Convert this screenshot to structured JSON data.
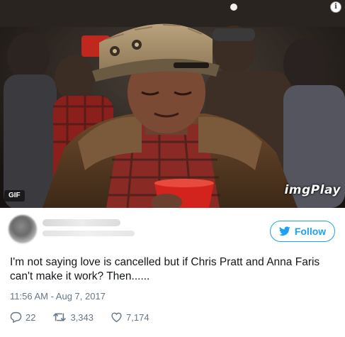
{
  "media": {
    "gif_badge": "GIF",
    "watermark": "imgPlay",
    "info_icon": "info-icon"
  },
  "author": {
    "name": "",
    "handle": ""
  },
  "follow_button": {
    "label": "Follow",
    "icon": "twitter-bird-icon",
    "color": "#1da1f2"
  },
  "tweet": {
    "text": "I'm not saying love is cancelled but if Chris Pratt and Anna Faris can't make it work? Then......",
    "timestamp": "11:56 AM - Aug 7, 2017"
  },
  "actions": {
    "replies": "22",
    "retweets": "3,343",
    "likes": "7,174"
  },
  "colors": {
    "text": "#14171a",
    "muted": "#657786",
    "accent": "#1da1f2"
  }
}
